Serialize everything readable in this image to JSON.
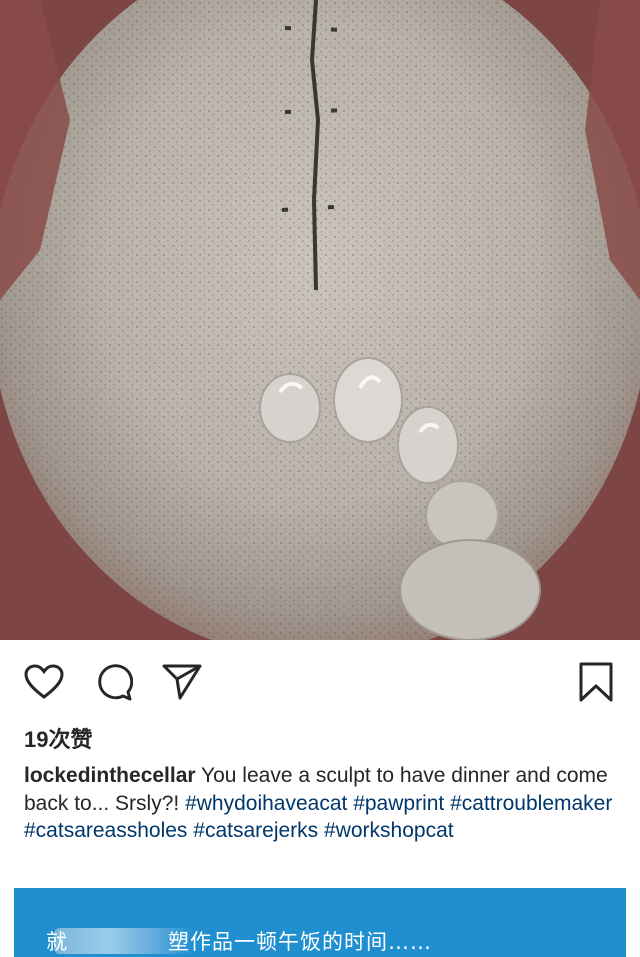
{
  "post": {
    "image_alt": "",
    "likes_label": "19次赞",
    "username": "lockedinthecellar",
    "caption_text": " You leave a sculpt to have dinner and come back to... Srsly?! ",
    "hashtags": [
      "#whydoihaveacat",
      "#pawprint",
      "#cattroublemaker",
      "#catsareassholes",
      "#catsarejerks",
      "#workshopcat"
    ]
  },
  "actions": {
    "like_icon": "heart-icon",
    "comment_icon": "comment-icon",
    "share_icon": "send-icon",
    "save_icon": "bookmark-icon"
  },
  "banner": {
    "text": "塑作品一顿午饭的时间……",
    "partial_prefix": "就"
  },
  "colors": {
    "banner": "#1f8fcf",
    "hashtag": "#00376b",
    "text": "#262626"
  }
}
